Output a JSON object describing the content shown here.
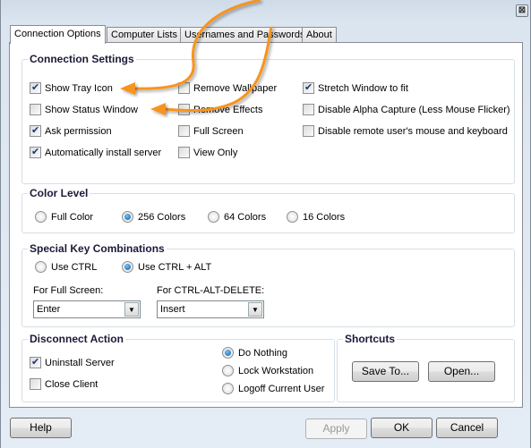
{
  "window": {
    "close_icon": "⊠"
  },
  "tabs": [
    {
      "label": "Connection Options",
      "active": true
    },
    {
      "label": "Computer Lists",
      "active": false
    },
    {
      "label": "Usernames and Passwords",
      "active": false
    },
    {
      "label": "About",
      "active": false
    }
  ],
  "connection_settings": {
    "title": "Connection Settings",
    "options": [
      {
        "label": "Show Tray Icon",
        "checked": true
      },
      {
        "label": "Show Status Window",
        "checked": false
      },
      {
        "label": "Ask permission",
        "checked": true
      },
      {
        "label": "Automatically install server",
        "checked": true
      },
      {
        "label": "Remove Wallpaper",
        "checked": false
      },
      {
        "label": "Remove Effects",
        "checked": false
      },
      {
        "label": "Full Screen",
        "checked": false
      },
      {
        "label": "View Only",
        "checked": false
      },
      {
        "label": "Stretch Window to fit",
        "checked": true
      },
      {
        "label": "Disable Alpha Capture (Less Mouse Flicker)",
        "checked": false
      },
      {
        "label": "Disable remote user's mouse and keyboard",
        "checked": false
      }
    ]
  },
  "color_level": {
    "title": "Color Level",
    "options": [
      "Full Color",
      "256 Colors",
      "64 Colors",
      "16 Colors"
    ],
    "selected": "256 Colors"
  },
  "special_keys": {
    "title": "Special Key Combinations",
    "options": [
      "Use CTRL",
      "Use CTRL + ALT"
    ],
    "selected": "Use CTRL + ALT",
    "full_screen_label": "For Full Screen:",
    "full_screen_value": "Enter",
    "cad_label": "For CTRL-ALT-DELETE:",
    "cad_value": "Insert"
  },
  "disconnect_action": {
    "title": "Disconnect Action",
    "checkboxes": [
      {
        "label": "Uninstall Server",
        "checked": true
      },
      {
        "label": "Close Client",
        "checked": false
      }
    ],
    "radios": [
      "Do Nothing",
      "Lock Workstation",
      "Logoff Current User"
    ],
    "selected": "Do Nothing"
  },
  "shortcuts": {
    "title": "Shortcuts",
    "save_label": "Save To...",
    "open_label": "Open..."
  },
  "footer": {
    "help_label": "Help",
    "apply_label": "Apply",
    "ok_label": "OK",
    "cancel_label": "Cancel"
  },
  "annotation": {
    "arrow_color": "#f7941d"
  }
}
